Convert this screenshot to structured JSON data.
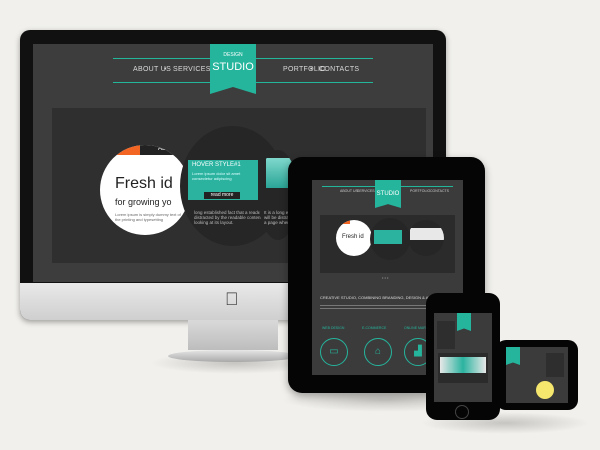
{
  "nav": {
    "brand_top": "DESIGN",
    "brand": "STUDIO",
    "left": [
      "ABOUT US",
      "SERVICES"
    ],
    "right": [
      "PORTFOLIO",
      "CONTACTS"
    ]
  },
  "slide": {
    "tab_label": "ABOU",
    "headline_1": "Fresh id",
    "headline_2": "for growing yo",
    "body": "Lorem ipsum is simply dummy text of the printing and typesetting",
    "hover_title": "HOVER STYLE#1",
    "hover_lines": "Lorem ipsum dolor sit amet consectetur adipiscing",
    "read_more": "read more",
    "mid_text": "long established fact that a reader distracted by the readable content looking at its layout.",
    "right_text": "It is a long est will be distract of a page when"
  },
  "tablet": {
    "tagline": "CREATIVE STUDIO, COMBINING BRANDING, DESIGN & ADVANCED TECH",
    "features": [
      "WEB DESIGN",
      "E-COMMERCE",
      "ONLINE MARKETING"
    ],
    "icons": [
      "monitor-icon",
      "basket-icon",
      "chart-icon"
    ]
  },
  "colors": {
    "accent": "#25b59d",
    "orange": "#f26522",
    "screen": "#3d3d3d"
  }
}
